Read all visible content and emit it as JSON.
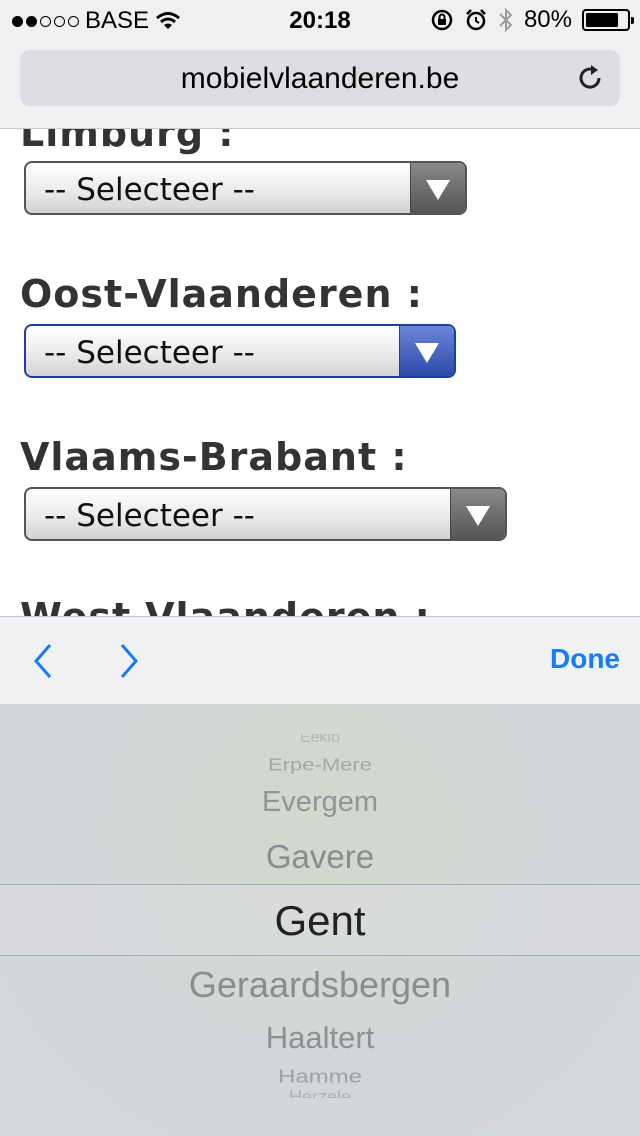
{
  "status_bar": {
    "carrier": "BASE",
    "time": "20:18",
    "battery": "80%",
    "battery_level": 0.8
  },
  "browser": {
    "url": "mobielvlaanderen.be"
  },
  "form": {
    "fields": [
      {
        "label": "Limburg :",
        "value": "-- Selecteer --"
      },
      {
        "label": "Oost-Vlaanderen :",
        "value": "-- Selecteer --"
      },
      {
        "label": "Vlaams-Brabant :",
        "value": "-- Selecteer --"
      },
      {
        "label": "West-Vlaanderen :"
      }
    ]
  },
  "accessory": {
    "done_label": "Done"
  },
  "picker": {
    "items": [
      "Eeklo",
      "Erpe-Mere",
      "Evergem",
      "Gavere",
      "Gent",
      "Geraardsbergen",
      "Haaltert",
      "Hamme",
      "Herzele"
    ],
    "selected": "Gent"
  },
  "colors": {
    "accent": "#1a7cf5",
    "focus_border": "#1f3f9a"
  }
}
